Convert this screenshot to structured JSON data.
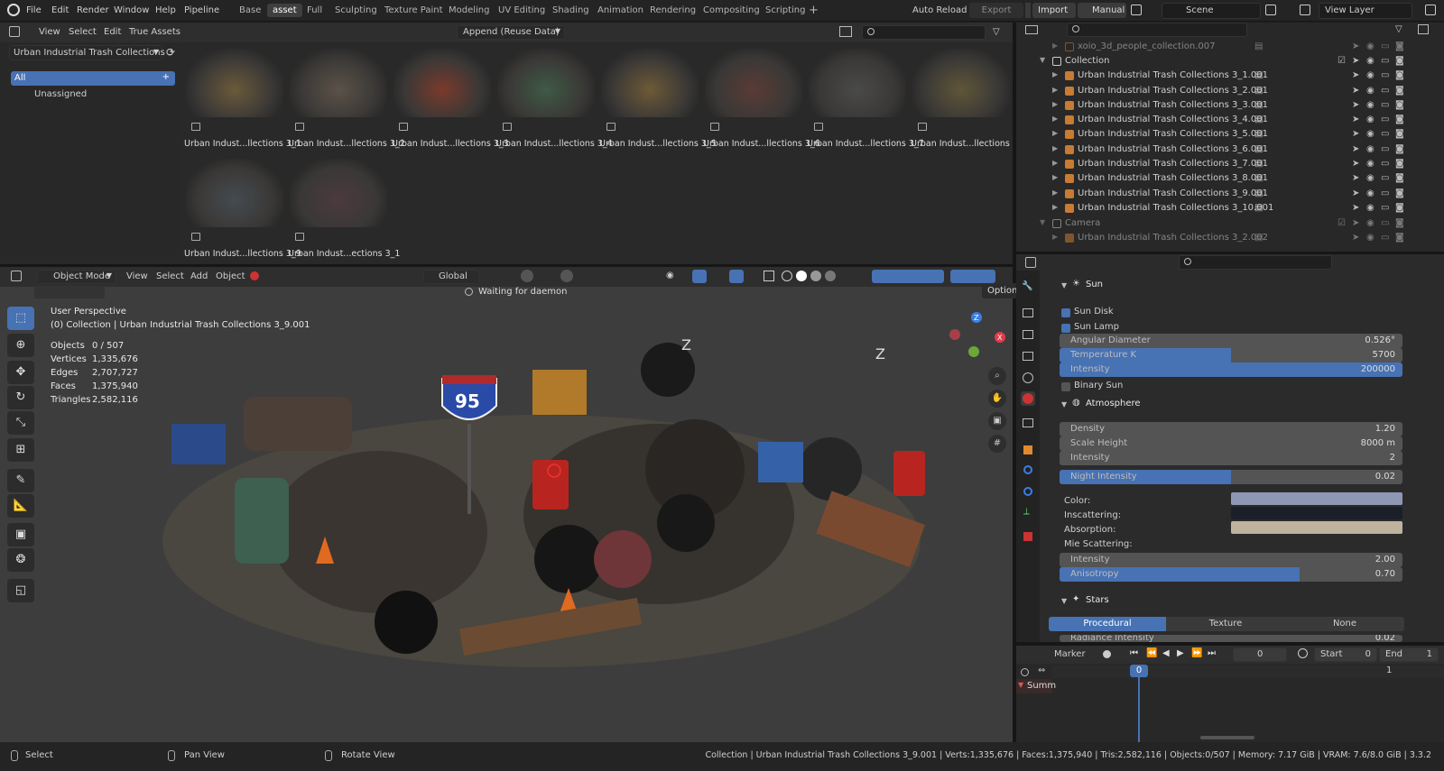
{
  "top": {
    "menu": [
      "File",
      "Edit",
      "Render",
      "Window",
      "Help",
      "Pipeline"
    ],
    "workspaces": [
      "Base",
      "asset",
      "Full",
      "Sculpting",
      "Texture Paint",
      "Modeling",
      "UV Editing",
      "Shading",
      "Animation",
      "Rendering",
      "Compositing",
      "Scripting"
    ],
    "active_workspace": "asset",
    "plus": "+",
    "auto_reload": "Auto Reload",
    "export": "Export",
    "import": "Import",
    "manual": "Manual",
    "scene": "Scene",
    "view_layer": "View Layer"
  },
  "asset_browser": {
    "menu": [
      "View",
      "Select",
      "Edit",
      "True Assets"
    ],
    "library": "Urban Industrial Trash Collections 3",
    "import_mode": "Append (Reuse Data)",
    "catalogs": [
      "All",
      "Unassigned"
    ],
    "assets": [
      {
        "label": "Urban Indust...llections 3_1",
        "color": "#6b5a3a"
      },
      {
        "label": "Urban Indust...llections 3_2",
        "color": "#5b5248"
      },
      {
        "label": "Urban Indust...llections 3_3",
        "color": "#7a3a2c"
      },
      {
        "label": "Urban Indust...llections 3_4",
        "color": "#3f5a45"
      },
      {
        "label": "Urban Indust...llections 3_5",
        "color": "#6e5a36"
      },
      {
        "label": "Urban Indust...llections 3_6",
        "color": "#5a3b36"
      },
      {
        "label": "Urban Indust...llections 3_7",
        "color": "#4a4a4a"
      },
      {
        "label": "Urban Indust...llections 3_8",
        "color": "#5f5638"
      },
      {
        "label": "Urban Indust...llections 3_9",
        "color": "#454b50"
      },
      {
        "label": "Urban Indust...ections 3_1",
        "color": "#4b3a3e"
      }
    ]
  },
  "outliner": {
    "rows": [
      {
        "label": "xoio_3d_people_collection.007",
        "type": "faded"
      },
      {
        "label": "Collection",
        "type": "collection"
      },
      {
        "label": "Urban Industrial Trash Collections 3_1.001",
        "type": "item"
      },
      {
        "label": "Urban Industrial Trash Collections 3_2.001",
        "type": "item"
      },
      {
        "label": "Urban Industrial Trash Collections 3_3.001",
        "type": "item"
      },
      {
        "label": "Urban Industrial Trash Collections 3_4.001",
        "type": "item"
      },
      {
        "label": "Urban Industrial Trash Collections 3_5.001",
        "type": "item"
      },
      {
        "label": "Urban Industrial Trash Collections 3_6.001",
        "type": "item"
      },
      {
        "label": "Urban Industrial Trash Collections 3_7.001",
        "type": "item"
      },
      {
        "label": "Urban Industrial Trash Collections 3_8.001",
        "type": "item"
      },
      {
        "label": "Urban Industrial Trash Collections 3_9.001",
        "type": "item"
      },
      {
        "label": "Urban Industrial Trash Collections 3_10.001",
        "type": "item"
      },
      {
        "label": "Camera",
        "type": "collection-dim"
      },
      {
        "label": "Urban Industrial Trash Collections 3_2.002",
        "type": "faded"
      }
    ]
  },
  "viewport": {
    "mode": "Object Mode",
    "menu": [
      "View",
      "Select",
      "Add",
      "Object"
    ],
    "orientation": "Global",
    "options": "Options",
    "status_msg": "Waiting for daemon",
    "perspective": "User Perspective",
    "active": "(0) Collection | Urban Industrial Trash Collections 3_9.001",
    "stats": [
      {
        "k": "Objects",
        "v": "0 / 507"
      },
      {
        "k": "Vertices",
        "v": "1,335,676"
      },
      {
        "k": "Edges",
        "v": "2,707,727"
      },
      {
        "k": "Faces",
        "v": "1,375,940"
      },
      {
        "k": "Triangles",
        "v": "2,582,116"
      }
    ],
    "axes": {
      "z": "Z",
      "x": "X"
    },
    "sign_number": "95",
    "sign_text": "INTERSTATE"
  },
  "properties": {
    "sun": {
      "title": "Sun",
      "sun_disk": "Sun Disk",
      "sun_lamp": "Sun Lamp",
      "angular_diameter": {
        "label": "Angular Diameter",
        "value": "0.526°"
      },
      "temperature": {
        "label": "Temperature K",
        "value": "5700",
        "fill": 0.5
      },
      "intensity": {
        "label": "Intensity",
        "value": "200000",
        "fill": 1.0
      },
      "binary_sun": "Binary Sun"
    },
    "atmosphere": {
      "title": "Atmosphere",
      "density": {
        "label": "Density",
        "value": "1.20"
      },
      "scale_height": {
        "label": "Scale Height",
        "value": "8000 m"
      },
      "intensity": {
        "label": "Intensity",
        "value": "2"
      },
      "night_intensity": {
        "label": "Night Intensity",
        "value": "0.02",
        "fill": 0.5
      },
      "color": "Color:",
      "inscattering": "Inscattering:",
      "absorption": "Absorption:",
      "color_swatch": "#8e98b5",
      "inscatter_swatch": "#1b1f2a",
      "absorption_swatch": "#bfb39f",
      "mie": "Mie Scattering:",
      "mie_intensity": {
        "label": "Intensity",
        "value": "2.00"
      },
      "anisotropy": {
        "label": "Anisotropy",
        "value": "0.70",
        "fill": 0.7
      }
    },
    "stars": {
      "title": "Stars",
      "tabs": [
        "Procedural",
        "Texture",
        "None"
      ],
      "radiance": {
        "label": "Radiance Intensity",
        "value": "0.02"
      }
    }
  },
  "timeline": {
    "marker": "Marker",
    "frame": "0",
    "start_label": "Start",
    "start": "0",
    "end_label": "End",
    "end": "1",
    "cursor": "0",
    "right_num": "1",
    "summary": "Summ"
  },
  "statusbar": {
    "select": "Select",
    "pan": "Pan View",
    "rotate": "Rotate View",
    "info": "Collection | Urban Industrial Trash Collections 3_9.001 | Verts:1,335,676 | Faces:1,375,940 | Tris:2,582,116 | Objects:0/507 | Memory: 7.17 GiB | VRAM: 7.6/8.0 GiB | 3.3.2"
  },
  "colors": {
    "accent": "#4772b3",
    "object_icon": "#c77b33"
  }
}
